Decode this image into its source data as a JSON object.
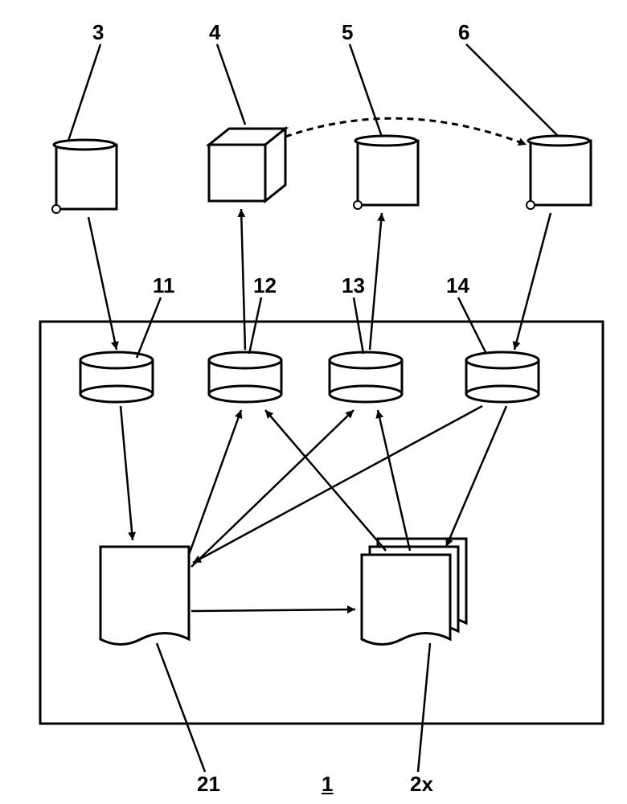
{
  "labels": {
    "top": {
      "l3": "3",
      "l4": "4",
      "l5": "5",
      "l6": "6"
    },
    "mid": {
      "l11": "11",
      "l12": "12",
      "l13": "13",
      "l14": "14"
    },
    "bottom": {
      "l21": "21",
      "l1": "1",
      "l2x": "2x"
    }
  },
  "diagram": {
    "type": "dataflow",
    "external_nodes": [
      {
        "id": 3,
        "kind": "scroll-document"
      },
      {
        "id": 4,
        "kind": "cube"
      },
      {
        "id": 5,
        "kind": "scroll-document"
      },
      {
        "id": 6,
        "kind": "scroll-document"
      }
    ],
    "system_boundary": 1,
    "stores": [
      11,
      12,
      13,
      14
    ],
    "processes": [
      {
        "id": 21,
        "kind": "document"
      },
      {
        "id": "2x",
        "kind": "document-stack"
      }
    ],
    "flows": [
      {
        "from": 3,
        "to": 11,
        "style": "solid"
      },
      {
        "from": 12,
        "to": 4,
        "style": "solid"
      },
      {
        "from": 13,
        "to": 5,
        "style": "solid"
      },
      {
        "from": 6,
        "to": 14,
        "style": "solid"
      },
      {
        "from": 4,
        "to": 6,
        "style": "dashed"
      },
      {
        "from": 11,
        "to": 21,
        "style": "solid"
      },
      {
        "from": 14,
        "to": 21,
        "style": "solid"
      },
      {
        "from": 21,
        "to": 12,
        "style": "solid"
      },
      {
        "from": 21,
        "to": 13,
        "style": "solid"
      },
      {
        "from": 21,
        "to": "2x",
        "style": "solid"
      },
      {
        "from": "2x",
        "to": 12,
        "style": "solid"
      },
      {
        "from": "2x",
        "to": 13,
        "style": "solid"
      },
      {
        "from": 14,
        "to": "2x",
        "style": "solid"
      }
    ]
  }
}
